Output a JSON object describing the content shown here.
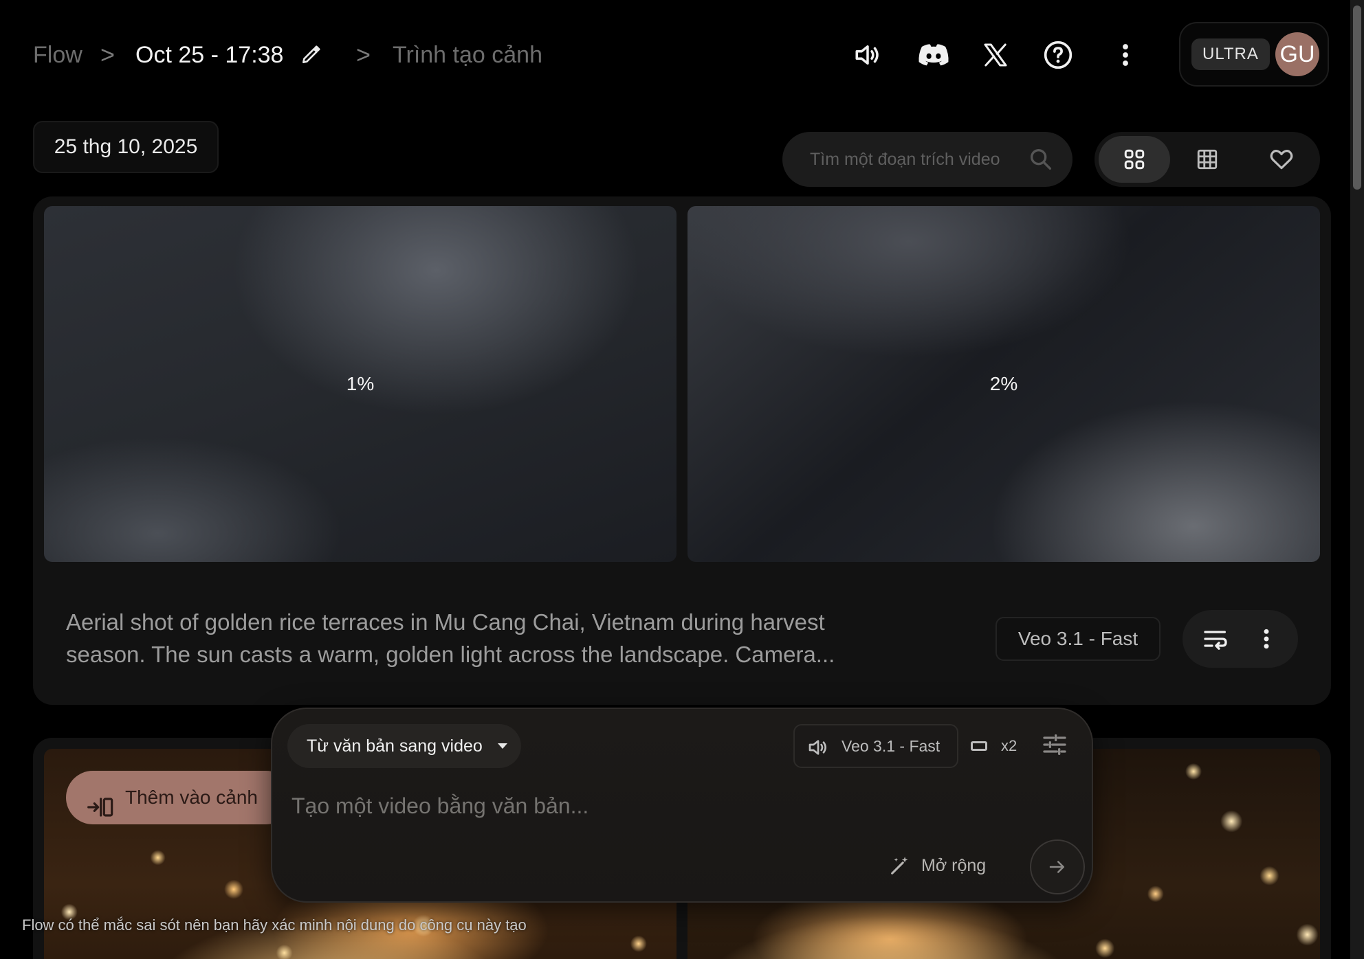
{
  "breadcrumb": {
    "root": "Flow",
    "separator": ">",
    "project_title": "Oct 25 - 17:38",
    "current_page": "Trình tạo cảnh"
  },
  "header_icons": [
    "volume-icon",
    "discord-icon",
    "x-logo-icon",
    "help-icon",
    "more-vert-icon"
  ],
  "account": {
    "plan_badge": "ULTRA",
    "avatar_initials": "GU",
    "avatar_color": "#9a7065"
  },
  "toolbar": {
    "date_label": "25 thg 10, 2025",
    "search_placeholder": "Tìm một đoạn trích video",
    "view_modes": [
      "grid-2-icon",
      "grid-3-icon",
      "favorite-icon"
    ],
    "active_view": "grid-2-icon"
  },
  "generation": {
    "clips": [
      {
        "progress_label": "1%",
        "progress": 0.01
      },
      {
        "progress_label": "2%",
        "progress": 0.02
      }
    ],
    "prompt": "Aerial shot of golden rice terraces in Mu Cang Chai, Vietnam during harvest season. The sun casts a warm, golden light across the landscape. Camera...",
    "model": "Veo 3.1 - Fast"
  },
  "next_card": {
    "add_to_scene_label": "Thêm vào cảnh"
  },
  "composer": {
    "mode": "Từ văn bản sang video",
    "model": "Veo 3.1 - Fast",
    "output_count": "x2",
    "placeholder": "Tạo một video bằng văn bản...",
    "expand_label": "Mở rộng"
  },
  "disclaimer": "Flow có thể mắc sai sót nên bạn hãy xác minh nội dung do công cụ này tạo",
  "colors": {
    "background": "#000000",
    "card": "#121212",
    "accent_button": "#a2766b"
  }
}
